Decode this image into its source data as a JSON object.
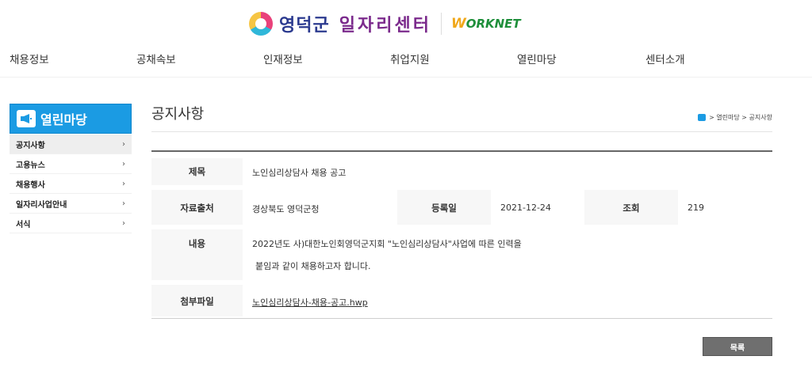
{
  "header": {
    "logo_name": "영덕군",
    "logo_center": "일자리센터",
    "worknet_w": "W",
    "worknet_rest": "ORKNET"
  },
  "gnb": [
    "채용정보",
    "공채속보",
    "인재정보",
    "취업지원",
    "열린마당",
    "센터소개"
  ],
  "sidebar": {
    "title": "열린마당",
    "icon": "megaphone-icon",
    "items": [
      {
        "label": "공지사항",
        "active": true
      },
      {
        "label": "고용뉴스",
        "active": false
      },
      {
        "label": "채용행사",
        "active": false
      },
      {
        "label": "일자리사업안내",
        "active": false
      },
      {
        "label": "서식",
        "active": false
      }
    ],
    "chevron": "›"
  },
  "page": {
    "title": "공지사항",
    "breadcrumb": "> 열린마당 > 공지사항"
  },
  "post": {
    "subject_label": "제목",
    "subject": "노인심리상담사 채용 공고",
    "source_label": "자료출처",
    "source": "경상북도 영덕군청",
    "date_label": "등록일",
    "date": "2021-12-24",
    "views_label": "조회",
    "views": "219",
    "content_label": "내용",
    "content_line1": "2022년도 사)대한노인회영덕군지회 \"노인심리상담사\"사업에 따른 인력을",
    "content_line2": "붙임과 같이 채용하고자 합니다.",
    "attach_label": "첨부파일",
    "attach": "노인심리상담사-채용-공고.hwp"
  },
  "list_button": "목록",
  "colors": {
    "accent": "#1b9be3",
    "button": "#6f6f6f"
  }
}
